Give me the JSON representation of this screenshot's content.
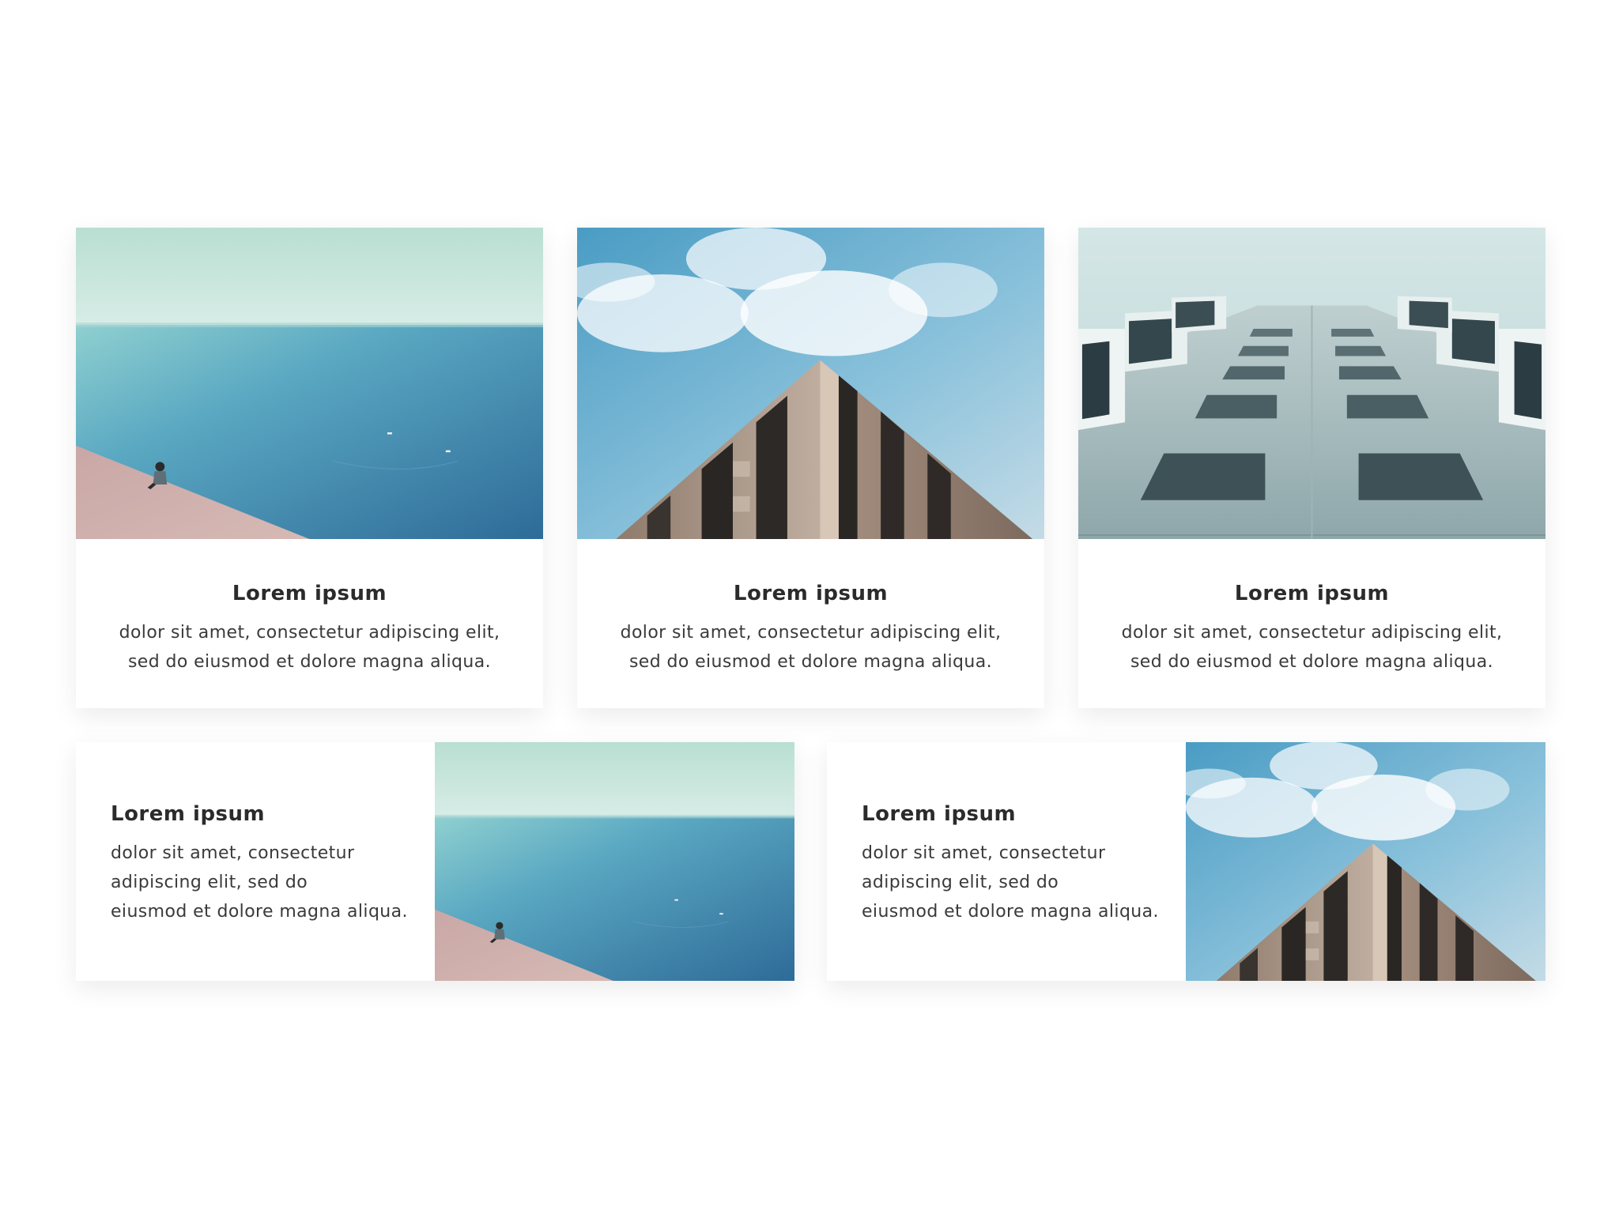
{
  "cards_top": [
    {
      "title": "Lorem ipsum",
      "description": "dolor sit amet, consectetur adipiscing elit,\nsed do eiusmod et dolore magna aliqua.",
      "image": "sea-hill-photo"
    },
    {
      "title": "Lorem ipsum",
      "description": "dolor sit amet, consectetur adipiscing elit,\nsed do eiusmod et dolore magna aliqua.",
      "image": "building-corner-sky-photo"
    },
    {
      "title": "Lorem ipsum",
      "description": "dolor sit amet, consectetur adipiscing elit,\nsed do eiusmod et dolore magna aliqua.",
      "image": "apartment-facade-photo"
    }
  ],
  "cards_bottom": [
    {
      "title": "Lorem ipsum",
      "description": "dolor sit amet, consectetur\nadipiscing elit, sed do\neiusmod et dolore magna aliqua.",
      "image": "sea-hill-photo"
    },
    {
      "title": "Lorem ipsum",
      "description": "dolor sit amet, consectetur\nadipiscing elit, sed do\neiusmod et dolore magna aliqua.",
      "image": "building-corner-sky-photo"
    }
  ],
  "colors": {
    "background": "#ffffff",
    "card": "#ffffff",
    "title_text": "#2b2b2b",
    "body_text": "#3a3a3a",
    "sea": "#3f86a8",
    "sky": "#6fb0d1",
    "sand": "#c9a5a5",
    "concrete": "#b39e8f"
  }
}
